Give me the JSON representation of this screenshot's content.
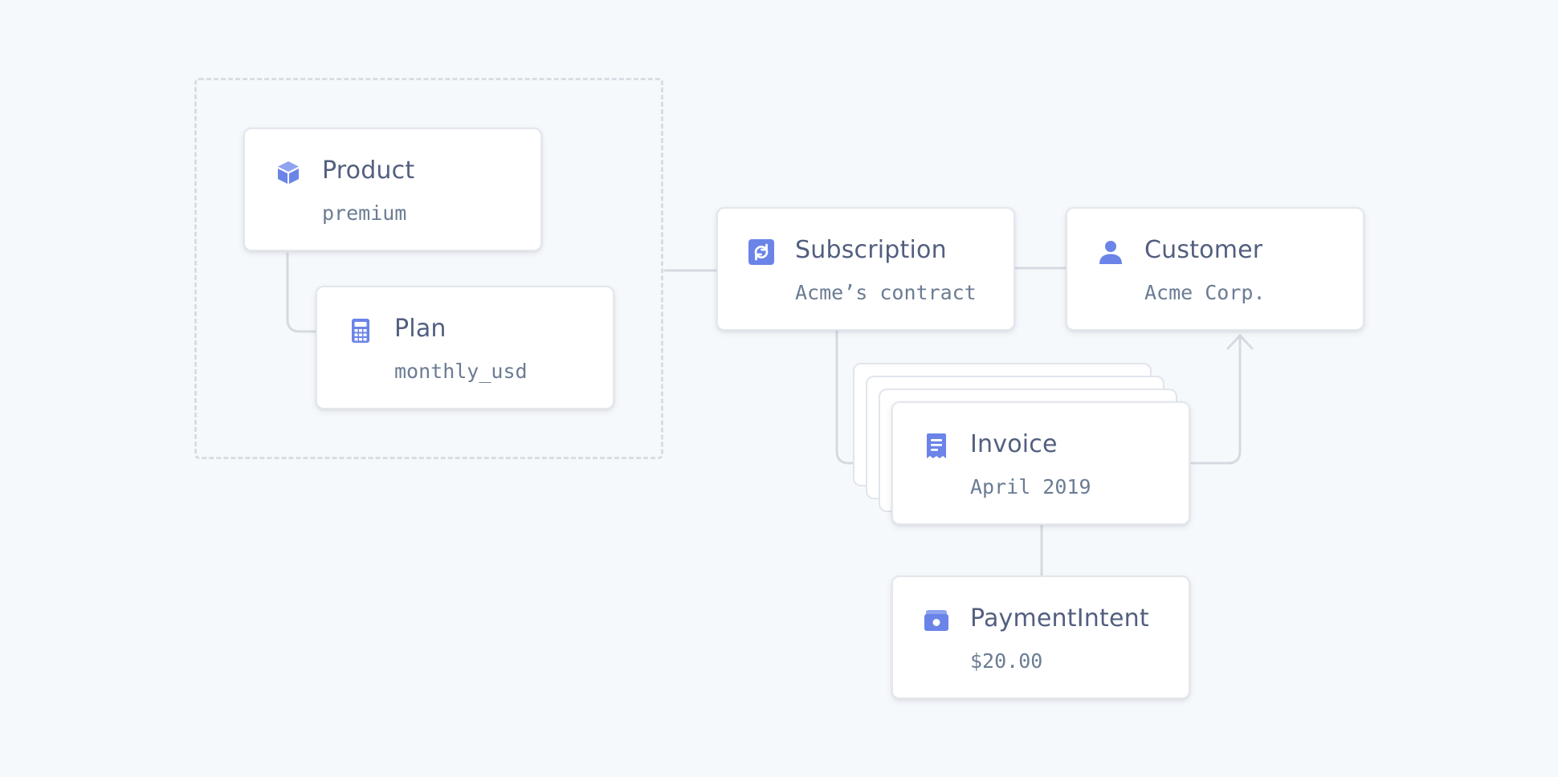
{
  "colors": {
    "background": "#f6f9fc",
    "card": "#ffffff",
    "card_border": "#e3e7ec",
    "connector": "#d5dae1",
    "group_border": "#d9dde3",
    "icon": "#6b84e8",
    "title_text": "#525f7f",
    "subtitle_text": "#6b7c93"
  },
  "nodes": {
    "product": {
      "title": "Product",
      "subtitle": "premium",
      "icon": "box-icon"
    },
    "plan": {
      "title": "Plan",
      "subtitle": "monthly_usd",
      "icon": "calculator-icon"
    },
    "subscription": {
      "title": "Subscription",
      "subtitle": "Acme’s contract",
      "icon": "recurring-icon"
    },
    "customer": {
      "title": "Customer",
      "subtitle": "Acme Corp.",
      "icon": "person-icon"
    },
    "invoice": {
      "title": "Invoice",
      "subtitle": "April 2019",
      "icon": "receipt-icon"
    },
    "payment_intent": {
      "title": "PaymentIntent",
      "subtitle": "$20.00",
      "icon": "payment-icon"
    }
  }
}
